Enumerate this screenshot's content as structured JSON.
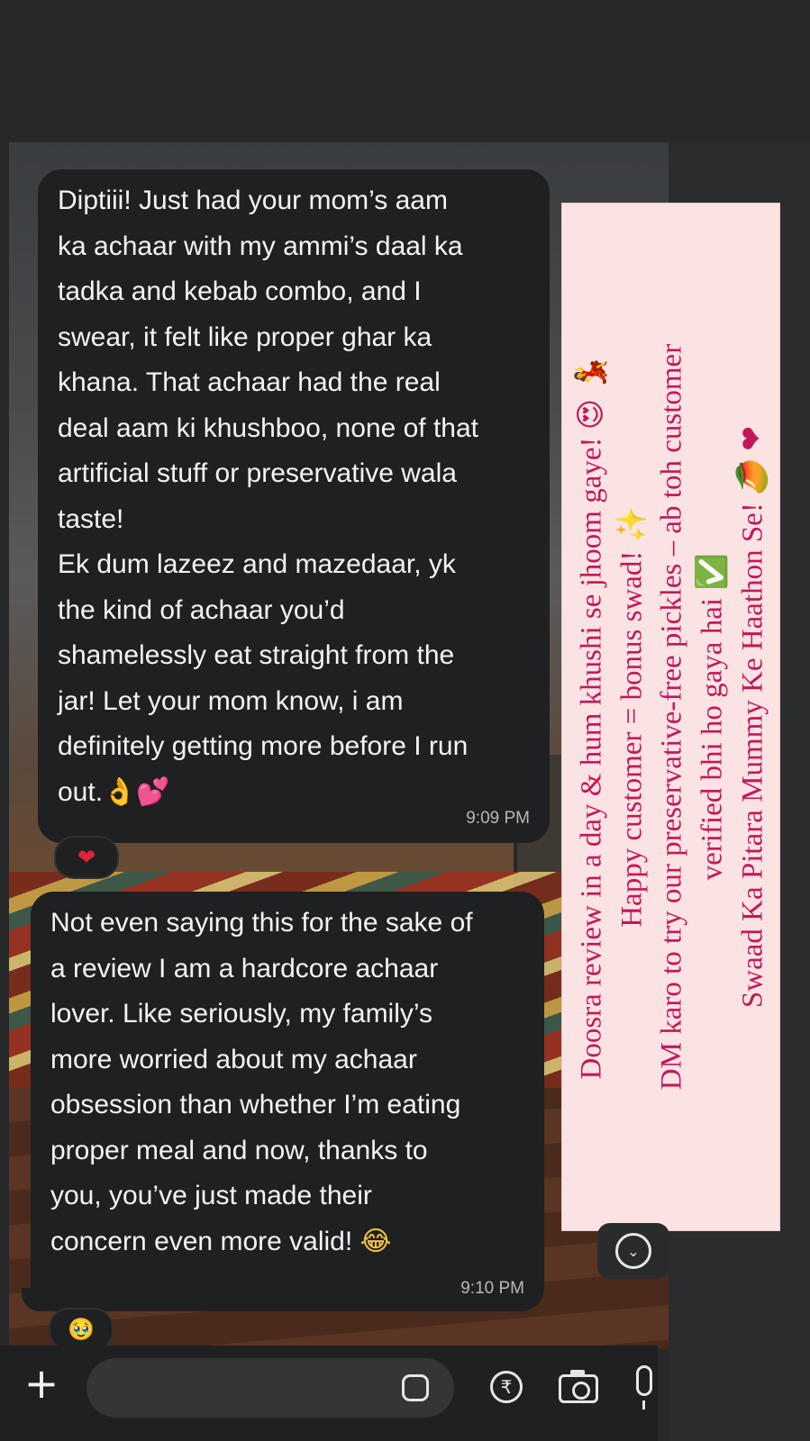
{
  "messages": [
    {
      "text": "Diptiii! Just had your mom’s aam\nka achaar with my ammi’s daal ka\ntadka and kebab combo, and I\nswear, it felt like proper ghar ka\nkhana. That achaar had the real\ndeal aam ki khushboo, none of that\nartificial stuff or preservative wala\ntaste!\nEk dum lazeez and mazedaar, yk\nthe kind of achaar you’d\nshamelessly eat straight from the\njar! Let your mom know, i am\ndefinitely getting more before I run\nout.",
      "emoji_1": "👌",
      "emoji_2": "💕",
      "time": "9:09 PM",
      "reaction": "❤"
    },
    {
      "text": "Not even saying this for the sake of\na review I am a hardcore achaar\nlover. Like seriously, my family’s\nmore worried about my achaar\nobsession than whether I’m eating\nproper meal and now, thanks to\nyou, you’ve just made their\nconcern even more valid!",
      "emoji_1": "😂",
      "time": "9:10 PM",
      "reaction": "🥹"
    }
  ],
  "sticker": {
    "line1": "Doosra review in a day & hum khushi se jhoom gaye!",
    "line1_emoji_a": "😍",
    "line1_emoji_b": "💃",
    "line2": "Happy customer = bonus swad!",
    "line2_emoji": "✨",
    "line3": "DM karo to try our preservative-free pickles – ab toh customer",
    "line4": "verified bhi ho gaya hai",
    "line4_emoji": "✅",
    "line5": "Swaad Ka Pitara Mummy Ke Haathon Se!",
    "line5_emoji_a": "🥭",
    "line5_emoji_b": "❤"
  },
  "input_bar": {
    "plus_symbol": "+",
    "rupee_symbol": "₹",
    "scroll_symbol": "⌄"
  },
  "colors": {
    "bubble": "#1f2021",
    "sticker_bg": "#fbe3e3",
    "sticker_text": "#c2185b",
    "heart": "#e0233b"
  },
  "icons": [
    "plus-icon",
    "sticker-icon",
    "rupee-icon",
    "camera-icon",
    "mic-icon",
    "scroll-down-icon"
  ]
}
